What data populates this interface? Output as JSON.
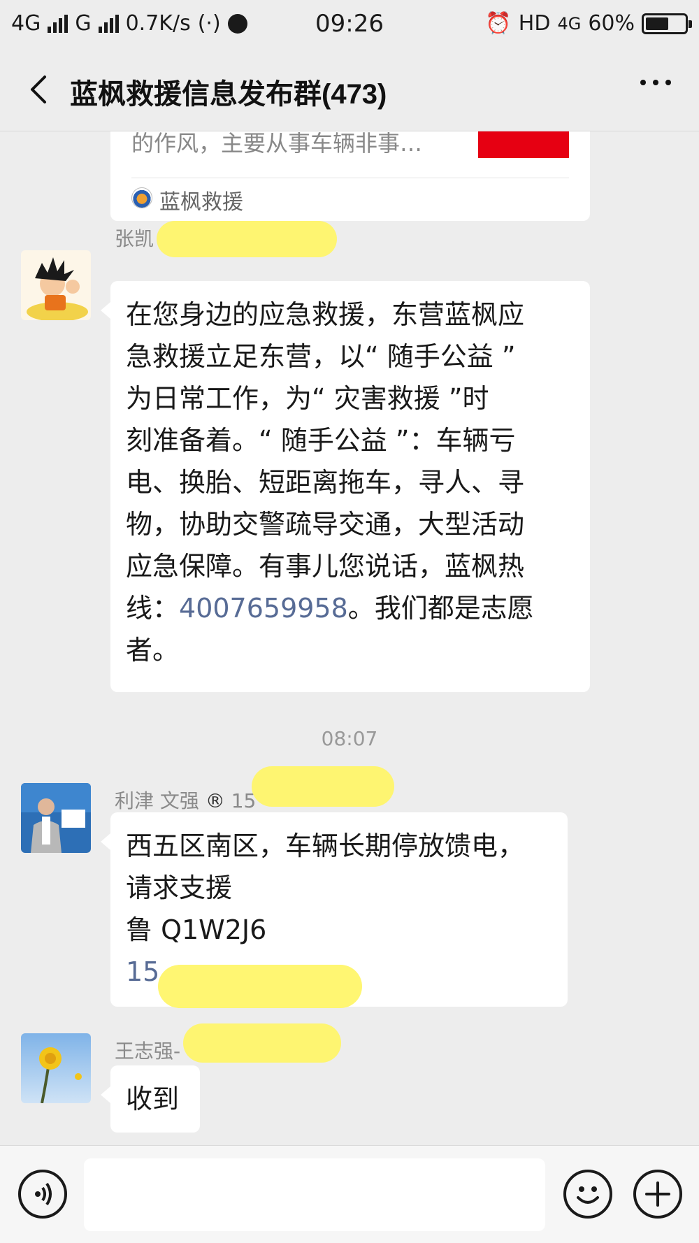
{
  "status_bar": {
    "network1": "4G",
    "network2": "G",
    "speed": "0.7K/s",
    "time": "09:26",
    "hd": "HD",
    "network3": "4G",
    "battery": "60%",
    "battery_level": 0.6
  },
  "header": {
    "title": "蓝枫救援信息发布群(473)",
    "back_icon": "chevron-left-icon",
    "more_icon": "more-dots-icon"
  },
  "share_card": {
    "description": "的作风，主要从事车辆非事…",
    "source": "蓝枫救援",
    "thumb_color": "#e60012"
  },
  "messages": [
    {
      "sender": "张凯",
      "lines": [
        "在您身边的应急救援，东营蓝枫应",
        "急救援立足东营，以“ 随手公益 ”",
        "为日常工作，为“ 灾害救援 ”时",
        "刻准备着。“ 随手公益 ”：车辆亏",
        "电、换胎、短距离拖车，寻人、寻",
        "物，协助交警疏导交通，大型活动",
        "应急保障。有事儿您说话，蓝枫热"
      ],
      "line8_prefix": "线：",
      "phone": "4007659958",
      "line8_suffix": "。我们都是志愿",
      "line9": "者。"
    },
    {
      "timestamp": "08:07"
    },
    {
      "sender": "利津  文强",
      "sender_mark": "®",
      "sender_phone_partial": "15",
      "lines": [
        "西五区南区，车辆长期停放馈电，",
        "请求支援",
        "鲁 Q1W2J6"
      ],
      "phone_partial": "15"
    },
    {
      "sender": "王志强-",
      "text": "收到"
    }
  ],
  "input_bar": {
    "voice_icon": "voice-icon",
    "emoji_icon": "emoji-icon",
    "plus_icon": "plus-icon",
    "placeholder": ""
  },
  "colors": {
    "background": "#ededed",
    "bubble": "#ffffff",
    "link": "#576b95",
    "redaction": "#fff56a"
  }
}
